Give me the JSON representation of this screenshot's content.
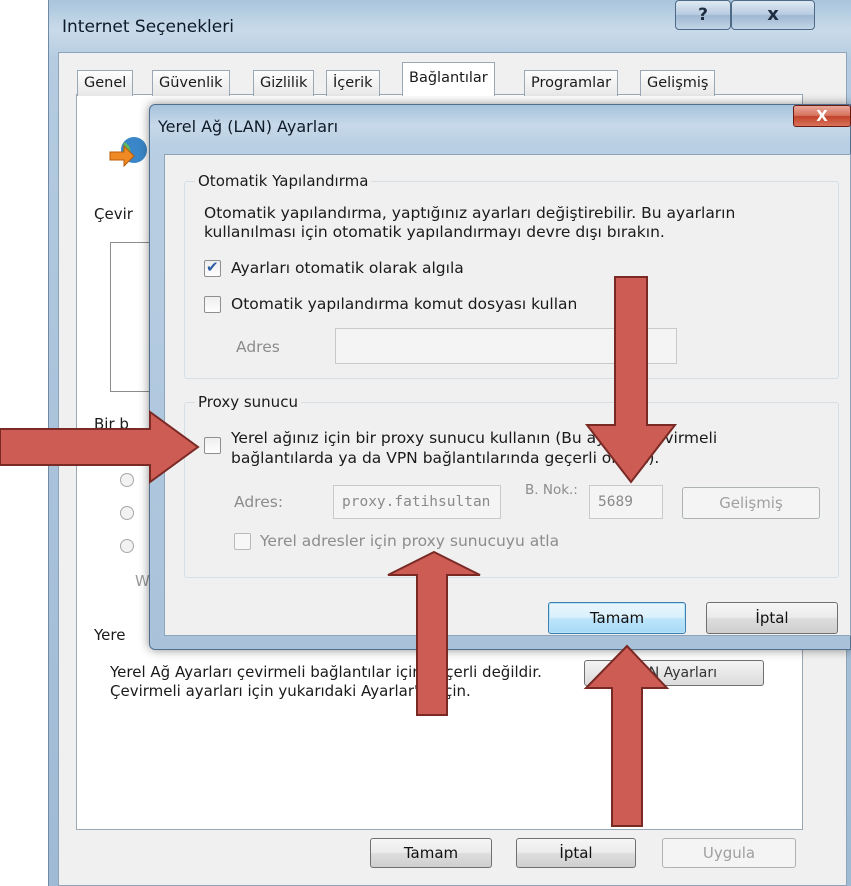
{
  "outer": {
    "title": "Internet Seçenekleri",
    "help_glyph": "?",
    "close_glyph": "x",
    "tabs": [
      {
        "label": "Genel"
      },
      {
        "label": "Güvenlik"
      },
      {
        "label": "Gizlilik"
      },
      {
        "label": "İçerik"
      },
      {
        "label": "Bağlantılar",
        "active": true
      },
      {
        "label": "Programlar"
      },
      {
        "label": "Gelişmiş"
      }
    ],
    "partial_cevir": "Çevir",
    "partial_bir": "Bir b",
    "partial_w": "W",
    "partial_yere": "Yere",
    "lan_section_text": "Yerel Ağ Ayarları çevirmeli bağlantılar için geçerli değildir. Çevirmeli ayarları için yukarıdaki Ayarlar'ı seçin.",
    "lan_settings_button": "LAN Ayarları",
    "buttons": {
      "ok": "Tamam",
      "cancel": "İptal",
      "apply": "Uygula"
    }
  },
  "lan_dialog": {
    "title": "Yerel Ağ (LAN) Ayarları",
    "close_glyph": "X",
    "auto_config": {
      "legend": "Otomatik Yapılandırma",
      "description": "Otomatik yapılandırma, yaptığınız ayarları değiştirebilir. Bu ayarların kullanılması için otomatik yapılandırmayı devre dışı bırakın.",
      "detect_label": "Ayarları otomatik olarak algıla",
      "detect_checked": true,
      "script_label": "Otomatik yapılandırma komut dosyası kullan",
      "script_checked": false,
      "address_label": "Adres",
      "address_value": ""
    },
    "proxy": {
      "legend": "Proxy sunucu",
      "use_proxy_label": "Yerel ağınız için bir proxy sunucu kullanın (Bu ayarlar çevirmeli bağlantılarda ya da VPN bağlantılarında geçerli olmaz).",
      "use_proxy_checked": false,
      "address_label": "Adres:",
      "address_value": "proxy.fatihsultan",
      "port_label": "B. Nok.:",
      "port_value": "5689",
      "advanced_button": "Gelişmiş",
      "bypass_label": "Yerel adresler için proxy sunucuyu atla",
      "bypass_checked": false
    },
    "buttons": {
      "ok": "Tamam",
      "cancel": "İptal"
    }
  },
  "annotation": {
    "arrow_color": "#cd5c55",
    "arrow_stroke": "#7a2a25"
  }
}
